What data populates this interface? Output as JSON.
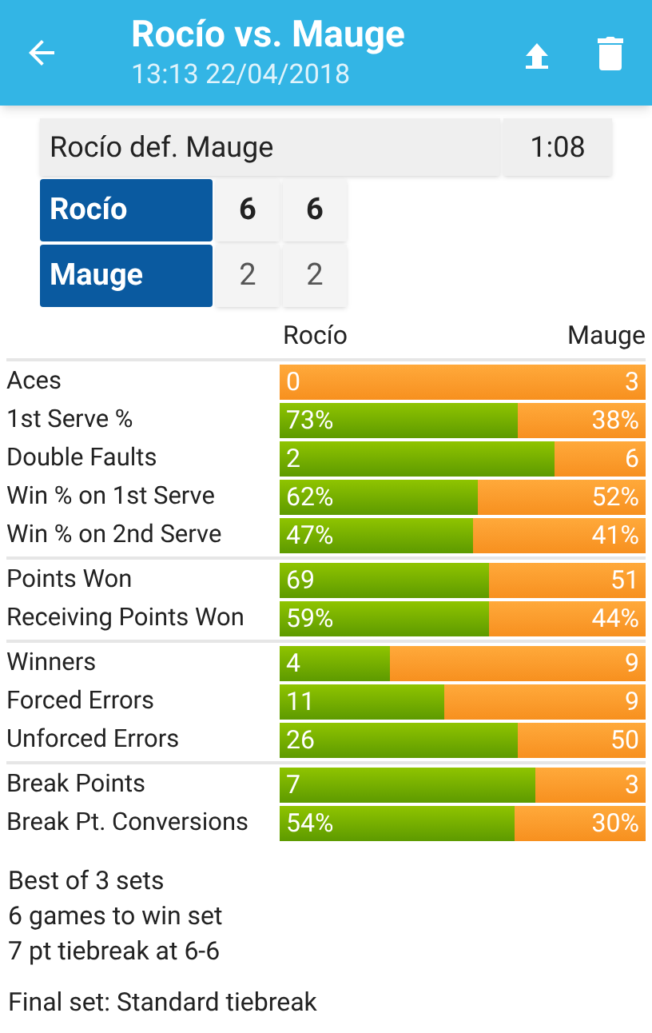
{
  "header": {
    "title": "Rocío vs. Mauge",
    "subtitle": "13:13 22/04/2018"
  },
  "result": {
    "summary": "Rocío def. Mauge",
    "duration": "1:08"
  },
  "score_rows": [
    {
      "player": "Rocío",
      "winner": true,
      "sets": [
        "6",
        "6"
      ]
    },
    {
      "player": "Mauge",
      "winner": false,
      "sets": [
        "2",
        "2"
      ]
    }
  ],
  "stats_header": {
    "player_1": "Rocío",
    "player_2": "Mauge"
  },
  "stat_groups": [
    [
      {
        "label": "Aces",
        "value_1": "0",
        "value_2": "3"
      },
      {
        "label": "1st Serve %",
        "value_1": "73%",
        "value_2": "38%",
        "level": 0.65
      },
      {
        "label": "Double Faults",
        "value_1": "2",
        "value_2": "6",
        "level": 0.75
      },
      {
        "label": "Win % on 1st Serve",
        "value_1": "62%",
        "value_2": "52%",
        "level": 0.54
      },
      {
        "label": "Win % on 2nd Serve",
        "value_1": "47%",
        "value_2": "41%",
        "level": 0.53
      }
    ],
    [
      {
        "label": "Points Won",
        "value_1": "69",
        "value_2": "51",
        "level": 0.57
      },
      {
        "label": "Receiving Points Won",
        "value_1": "59%",
        "value_2": "44%",
        "level": 0.57
      }
    ],
    [
      {
        "label": "Winners",
        "value_1": "4",
        "value_2": "9",
        "level": 0.3
      },
      {
        "label": "Forced Errors",
        "value_1": "11",
        "value_2": "9",
        "level": 0.45
      },
      {
        "label": "Unforced Errors",
        "value_1": "26",
        "value_2": "50",
        "level": 0.65
      }
    ],
    [
      {
        "label": "Break Points",
        "value_1": "7",
        "value_2": "3",
        "level": 0.7
      },
      {
        "label": "Break Pt. Conversions",
        "value_1": "54%",
        "value_2": "30%",
        "level": 0.64
      }
    ]
  ],
  "rules": [
    "Best of 3 sets",
    "6 games to win set",
    "7 pt tiebreak at 6-6"
  ],
  "final_set": "Final set: Standard tiebreak"
}
